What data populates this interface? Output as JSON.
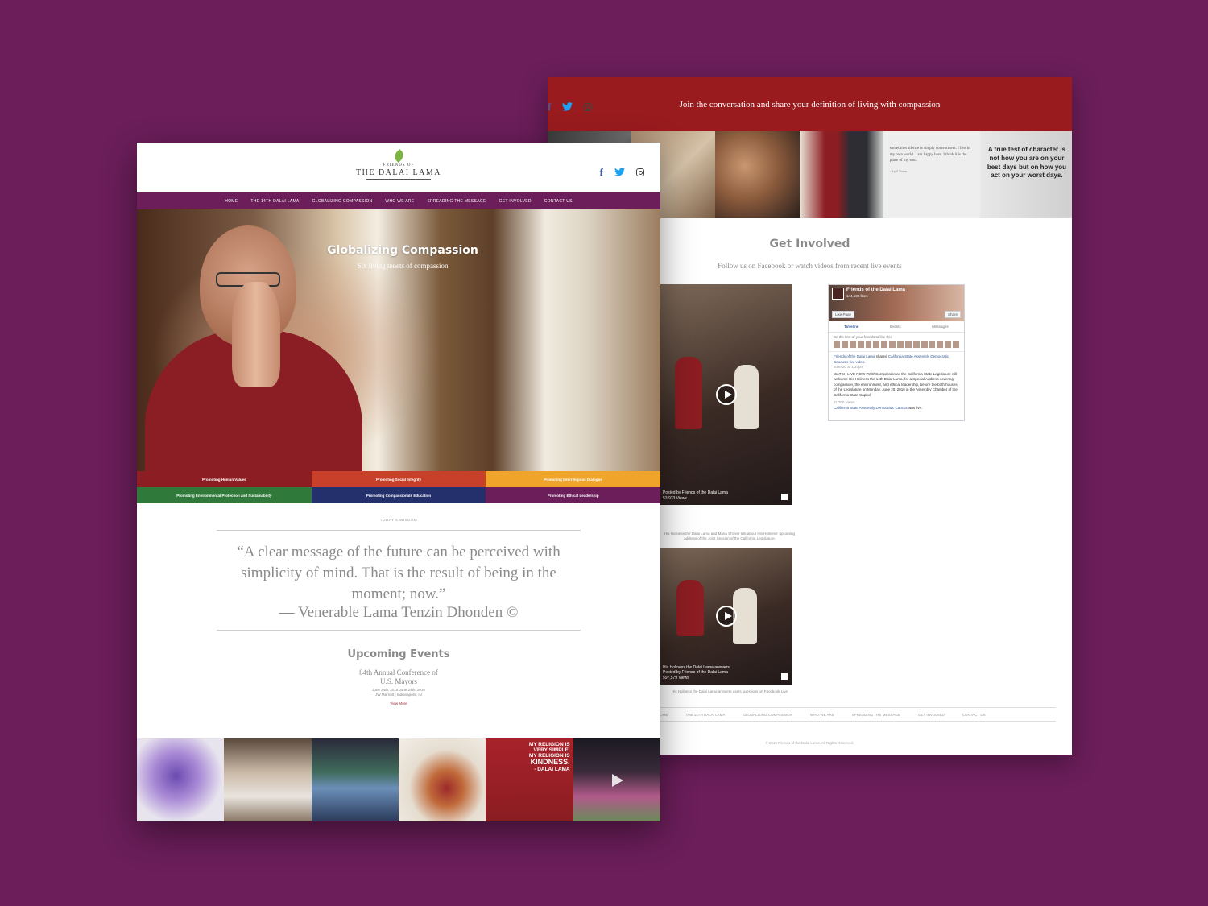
{
  "back": {
    "banner_tagline": "Join the conversation and share your definition of living with compassion",
    "strip_quote": {
      "text": "sometimes silence is simply contentment. I live in my own world. I am happy here. I think it is the place of my soul.",
      "author": "- April Green"
    },
    "strip_character": "A true test of character is not how you are on your best days but on how you act on your worst days.",
    "get_involved": {
      "title": "Get Involved",
      "subtitle": "Follow us on Facebook or watch videos from recent live events"
    },
    "videos": [
      {
        "meta_line1": "Posted by Friends of the Dalai Lama",
        "meta_line2": "53,933 Views",
        "caption": "His Holiness the Dalai Lama and Maria Shriver talk about His Holiness' upcoming address of the Joint Session of the California Legislature."
      },
      {
        "meta_line0": "His Holiness the Dalai Lama answers...",
        "meta_line1": "Posted by Friends of the Dalai Lama",
        "meta_line2": "597,579 Views",
        "caption": "His Holiness the Dalai Lama answers users questions on Facebook Live"
      }
    ],
    "facebook": {
      "page_name": "Friends of the Dalai Lama",
      "likes": "144,580 likes",
      "like_button": "Like Page",
      "share_button": "Share",
      "tabs": [
        "Timeline",
        "Events",
        "Messages"
      ],
      "friends_prompt": "Be the first of your friends to like this",
      "post_author": "Friends of the Dalai Lama",
      "post_action": "shared",
      "post_link": "California State Assembly Democratic Caucus's live video.",
      "post_time": "June 20 at 1:37pm",
      "post_body": "WATCH LIVE NOW #WithCompassion as the California State Legislature will welcome His Holiness the 14th Dalai Lama, for a Special Address covering compassion, the environment, and ethical leadership, before the both houses of the Legislature on Monday, June 20, 2016 in the Assembly Chamber of the California State Capitol",
      "views": "11,700 Views",
      "footer_link": "California State Assembly Democratic Caucus",
      "footer_suffix": "was live."
    },
    "footer_nav": [
      "HOME",
      "THE 14TH DALAI LAMA",
      "GLOBALIZING COMPASSION",
      "WHO WE ARE",
      "SPREADING THE MESSAGE",
      "GET INVOLVED",
      "CONTACT US"
    ],
    "copyright": "© 2016 Friends of the Dalai Lama. All Rights Reserved."
  },
  "front": {
    "logo": {
      "line1": "FRIENDS OF",
      "line2": "THE DALAI LAMA"
    },
    "nav": [
      "HOME",
      "THE 14TH DALAI LAMA",
      "GLOBALIZING COMPASSION",
      "WHO WE ARE",
      "SPREADING THE MESSAGE",
      "GET INVOLVED",
      "CONTACT US"
    ],
    "hero": {
      "title": "Globalizing Compassion",
      "subtitle": "Six living tenets of compassion"
    },
    "tenets": [
      {
        "label": "Promoting Human Values",
        "color": "#8c1d22"
      },
      {
        "label": "Promoting Social Integrity",
        "color": "#c9402a"
      },
      {
        "label": "Promoting Interreligious Dialogue",
        "color": "#f0a52a"
      },
      {
        "label": "Promoting Environmental Protection and Sustainability",
        "color": "#2f7a3a"
      },
      {
        "label": "Promoting Compassionate Education",
        "color": "#24306b"
      },
      {
        "label": "Promoting Ethical Leadership",
        "color": "#6b1e5a"
      }
    ],
    "wisdom": {
      "label": "TODAY'S WISDOM",
      "quote": "“A clear message of the future can be perceived with simplicity of mind. That is the result of being in the moment; now.”",
      "author": "— Venerable Lama Tenzin Dhonden ©"
    },
    "events": {
      "title": "Upcoming Events",
      "name_line1": "84th Annual Conference of",
      "name_line2": "U.S. Mayors",
      "date": "June 24th, 2016 June 24th, 2016",
      "place": "JW Marriott | Indianapolis, IN",
      "more": "View More"
    },
    "gallery_kindness": {
      "line1": "MY RELIGION IS",
      "line2": "VERY SIMPLE.",
      "line3": "MY RELIGION IS",
      "line4": "KINDNESS.",
      "line5": "- DALAI LAMA"
    }
  },
  "colors": {
    "background": "#6b1e5a",
    "banner_red": "#991b1e",
    "nav_purple": "#6b1e5a"
  }
}
